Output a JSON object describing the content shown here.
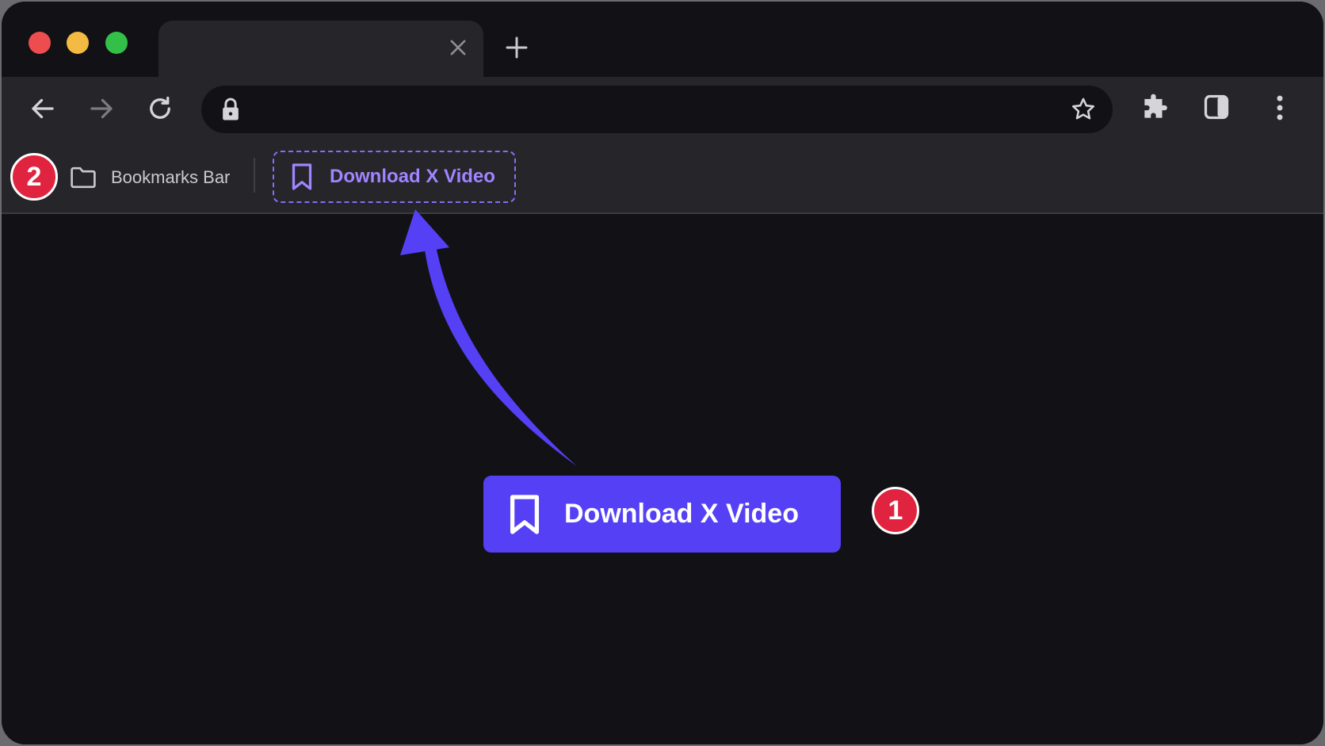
{
  "browser": {
    "tab": {
      "title": ""
    },
    "address_bar": {
      "value": "",
      "placeholder": ""
    }
  },
  "bookmarks_bar": {
    "folder_label": "Bookmarks Bar",
    "bookmark_label": "Download X Video",
    "step_badge": "2"
  },
  "content": {
    "cta_label": "Download X Video",
    "step_badge": "1"
  },
  "colors": {
    "accent": "#5540f5",
    "bookmark_text": "#a184ff",
    "badge": "#e0243f"
  }
}
